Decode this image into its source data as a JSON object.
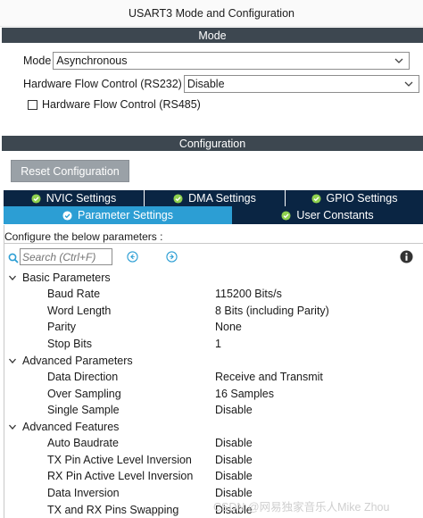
{
  "window": {
    "title": "USART3 Mode and Configuration"
  },
  "mode_section": {
    "header": "Mode",
    "mode": {
      "label": "Mode",
      "value": "Asynchronous"
    },
    "flow_control_rs232": {
      "label": "Hardware Flow Control (RS232)",
      "value": "Disable"
    },
    "flow_control_rs485": {
      "label": "Hardware Flow Control (RS485)",
      "checked": false
    }
  },
  "config_section": {
    "header": "Configuration",
    "reset_button": "Reset Configuration",
    "tabs_row1": [
      {
        "label": "NVIC Settings"
      },
      {
        "label": "DMA Settings"
      },
      {
        "label": "GPIO Settings"
      }
    ],
    "tabs_row2": [
      {
        "label": "Parameter Settings",
        "active": true
      },
      {
        "label": "User Constants",
        "active": false
      }
    ],
    "configure_label": "Configure the below parameters :",
    "search_placeholder": "Search (Ctrl+F)",
    "groups": [
      {
        "name": "Basic Parameters",
        "params": [
          {
            "name": "Baud Rate",
            "value": "115200 Bits/s"
          },
          {
            "name": "Word Length",
            "value": "8 Bits (including Parity)"
          },
          {
            "name": "Parity",
            "value": "None"
          },
          {
            "name": "Stop Bits",
            "value": "1"
          }
        ]
      },
      {
        "name": "Advanced Parameters",
        "params": [
          {
            "name": "Data Direction",
            "value": "Receive and Transmit"
          },
          {
            "name": "Over Sampling",
            "value": "16 Samples"
          },
          {
            "name": "Single Sample",
            "value": "Disable"
          }
        ]
      },
      {
        "name": "Advanced Features",
        "params": [
          {
            "name": "Auto Baudrate",
            "value": "Disable"
          },
          {
            "name": "TX Pin Active Level Inversion",
            "value": "Disable"
          },
          {
            "name": "RX Pin Active Level Inversion",
            "value": "Disable"
          },
          {
            "name": "Data Inversion",
            "value": "Disable"
          },
          {
            "name": "TX and RX Pins Swapping",
            "value": "Disable"
          }
        ]
      }
    ]
  },
  "watermark": "CSDN @网易独家音乐人Mike Zhou",
  "colors": {
    "section_header_bg": "#3d4750",
    "tab_dark_bg": "#0a2543",
    "tab_active_bg": "#2c9ed4",
    "reset_button_bg": "#9aa1a7",
    "icon_blue": "#2c9ed4"
  },
  "icons": {
    "tab_check": "check-circle-icon",
    "search": "search-icon",
    "nav_prev": "arrow-left-circle-icon",
    "nav_next": "arrow-right-circle-icon",
    "info": "info-icon",
    "group_expand": "chevron-down-icon",
    "select_dropdown": "chevron-down-icon"
  }
}
